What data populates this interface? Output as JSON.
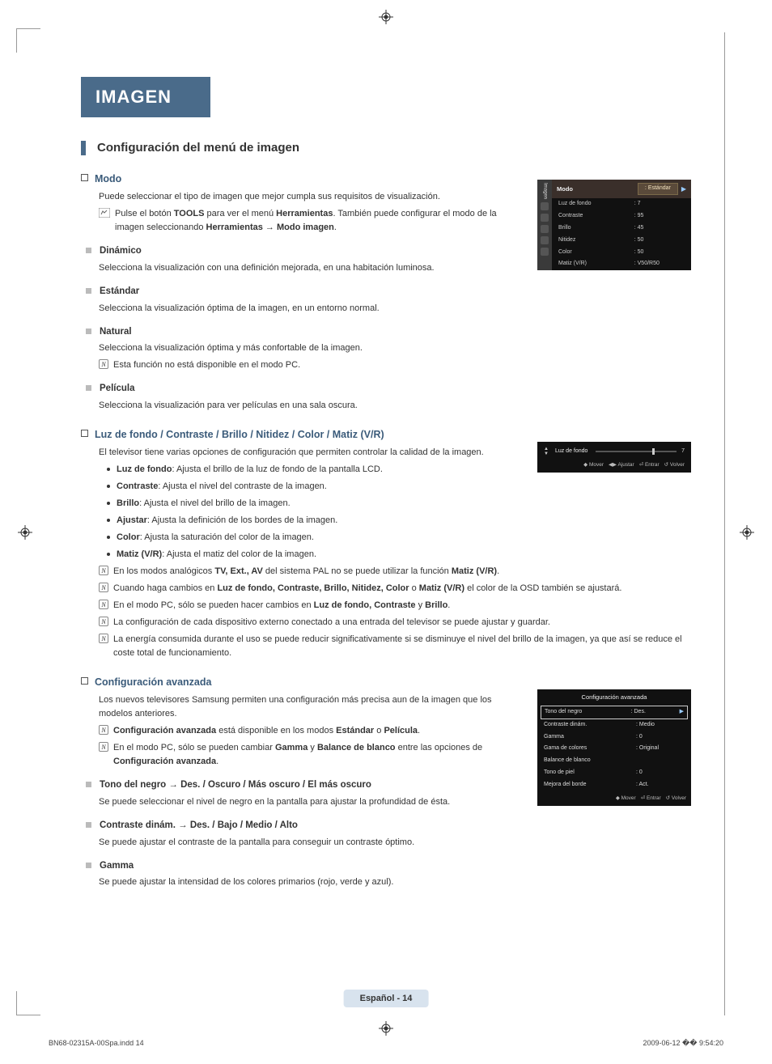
{
  "header": {
    "tab": "IMAGEN"
  },
  "section_title": "Configuración del menú de imagen",
  "modo": {
    "heading": "Modo",
    "intro": "Puede seleccionar el tipo de imagen que mejor cumpla sus requisitos de visualización.",
    "tools_pre": "Pulse el botón ",
    "tools_bold": "TOOLS",
    "tools_mid": " para ver el menú ",
    "tools_bold2": "Herramientas",
    "tools_after": ". También puede configurar el modo de la imagen seleccionando ",
    "tools_path1": "Herramientas",
    "tools_arrow": " → ",
    "tools_path2": "Modo imagen",
    "tools_end": ".",
    "items": [
      {
        "name": "Dinámico",
        "desc": "Selecciona la visualización con una definición mejorada, en una habitación luminosa."
      },
      {
        "name": "Estándar",
        "desc": "Selecciona la visualización óptima de la imagen, en un entorno normal."
      },
      {
        "name": "Natural",
        "desc": "Selecciona la visualización óptima y más confortable de la imagen.",
        "note": "Esta función no está disponible en el modo PC."
      },
      {
        "name": "Película",
        "desc": "Selecciona la visualización para ver películas en una sala oscura."
      }
    ]
  },
  "params": {
    "heading": "Luz de fondo / Contraste / Brillo / Nitidez / Color / Matiz (V/R)",
    "intro": "El televisor tiene varias opciones de configuración que permiten controlar la calidad de la imagen.",
    "bullets": [
      {
        "b": "Luz de fondo",
        "t": ": Ajusta el brillo de la luz de fondo de la pantalla LCD."
      },
      {
        "b": "Contraste",
        "t": ": Ajusta el nivel del contraste de la imagen."
      },
      {
        "b": "Brillo",
        "t": ": Ajusta el nivel del brillo de la imagen."
      },
      {
        "b": "Ajustar",
        "t": ": Ajusta la definición de los bordes de la imagen."
      },
      {
        "b": "Color",
        "t": ": Ajusta la saturación del color de la imagen."
      },
      {
        "b": "Matiz (V/R)",
        "t": ": Ajusta el matiz del color de la imagen."
      }
    ],
    "notes": {
      "n1a": "En los modos analógicos ",
      "n1b": "TV, Ext., AV",
      "n1c": " del sistema PAL no se puede utilizar la función ",
      "n1d": "Matiz (V/R)",
      "n1e": ".",
      "n2a": "Cuando haga cambios en ",
      "n2b": "Luz de fondo, Contraste, Brillo, Nitidez, Color",
      "n2c": " o ",
      "n2d": "Matiz (V/R)",
      "n2e": " el color de la OSD también se ajustará.",
      "n3a": "En el modo PC, sólo se pueden hacer cambios en ",
      "n3b": "Luz de fondo, Contraste",
      "n3c": " y ",
      "n3d": "Brillo",
      "n3e": ".",
      "n4": "La configuración de cada dispositivo externo conectado a una entrada del televisor se puede ajustar y guardar.",
      "n5": "La energía consumida durante el uso se puede reducir significativamente si se disminuye el nivel del brillo de la imagen, ya que así se reduce el coste total de funcionamiento."
    }
  },
  "adv": {
    "heading": "Configuración avanzada",
    "intro": "Los nuevos televisores Samsung permiten una configuración más precisa aun de la imagen que los modelos anteriores.",
    "note1_a": "Configuración avanzada",
    "note1_b": " está disponible en los modos ",
    "note1_c": "Estándar",
    "note1_d": " o ",
    "note1_e": "Película",
    "note1_f": ".",
    "note2_a": "En el modo PC, sólo se pueden cambiar ",
    "note2_b": "Gamma",
    "note2_c": " y ",
    "note2_d": "Balance de blanco",
    "note2_e": " entre las opciones de ",
    "note2_f": "Configuración avanzada",
    "note2_g": ".",
    "items": [
      {
        "name": "Tono del negro → Des. / Oscuro / Más oscuro / El más oscuro",
        "desc": "Se puede seleccionar el nivel de negro en la pantalla para ajustar la profundidad de ésta."
      },
      {
        "name": "Contraste dinám. → Des. / Bajo / Medio / Alto",
        "desc": "Se puede ajustar el contraste de la pantalla para conseguir un contraste óptimo."
      },
      {
        "name": "Gamma",
        "desc": "Se puede ajustar la intensidad de los colores primarios (rojo, verde y azul)."
      }
    ]
  },
  "osd_modo": {
    "side_lab": "Imagen",
    "mode_lab": "Modo",
    "mode_val": "Estándar",
    "rows": [
      {
        "k": "Luz de fondo",
        "v": ": 7"
      },
      {
        "k": "Contraste",
        "v": ": 95"
      },
      {
        "k": "Brillo",
        "v": ": 45"
      },
      {
        "k": "Nitidez",
        "v": ": 50"
      },
      {
        "k": "Color",
        "v": ": 50"
      }
    ],
    "dimrow": {
      "k": "Matiz (V/R)",
      "v": ": V50/R50"
    }
  },
  "osd_slider": {
    "label": "Luz de fondo",
    "value": "7",
    "nav": {
      "mover": "Mover",
      "ajustar": "Ajustar",
      "entrar": "Entrar",
      "volver": "Volver"
    }
  },
  "osd_adv": {
    "title": "Configuración avanzada",
    "rows": [
      {
        "k": "Tono del negro",
        "v": ": Des.",
        "sel": true
      },
      {
        "k": "Contraste dinám.",
        "v": ": Medio"
      },
      {
        "k": "Gamma",
        "v": ": 0"
      },
      {
        "k": "Gama de colores",
        "v": ": Original"
      },
      {
        "k": "Balance de blanco",
        "v": ""
      },
      {
        "k": "Tono de piel",
        "v": ": 0"
      },
      {
        "k": "Mejora del borde",
        "v": ": Act."
      }
    ],
    "nav": {
      "mover": "Mover",
      "entrar": "Entrar",
      "volver": "Volver"
    }
  },
  "footer": {
    "label": "Español - 14"
  },
  "print": {
    "left": "BN68-02315A-00Spa.indd   14",
    "right": "2009-06-12   �� 9:54:20"
  }
}
